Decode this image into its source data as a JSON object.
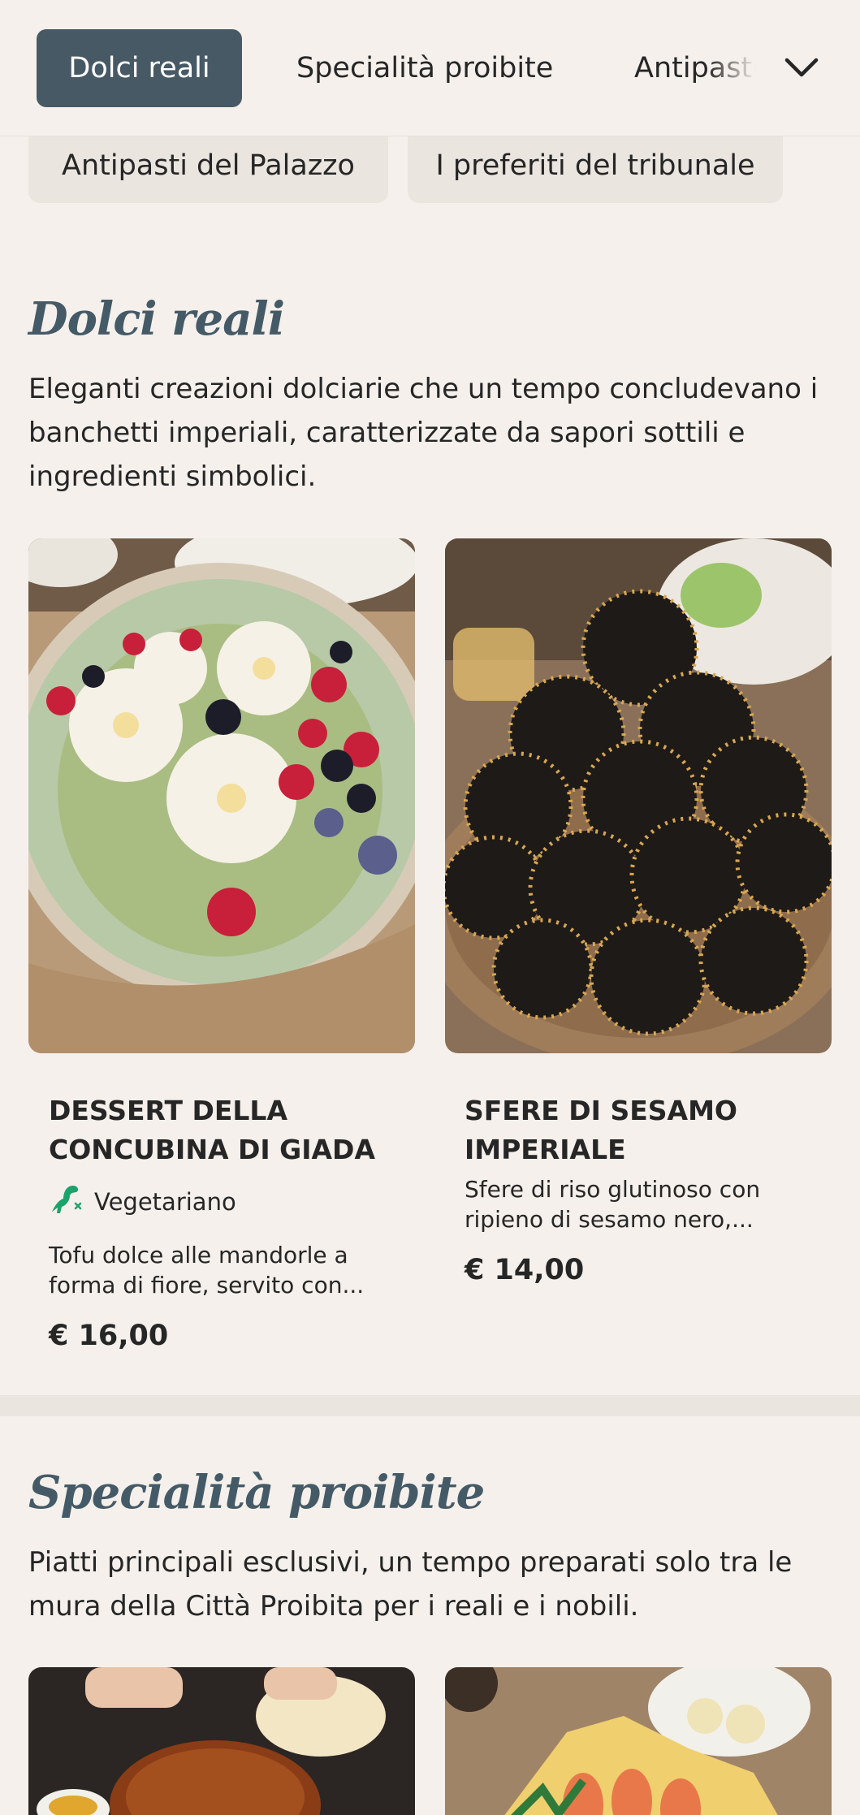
{
  "nav": {
    "tabs": [
      {
        "label": "Dolci reali",
        "active": true
      },
      {
        "label": "Specialità proibite",
        "active": false
      },
      {
        "label": "Antipasti del Palazzo",
        "active": false
      }
    ],
    "more_icon": "chevron-down-icon"
  },
  "chips": [
    {
      "label": "Antipasti del Palazzo"
    },
    {
      "label": "I preferiti del tribunale"
    }
  ],
  "sections": [
    {
      "title": "Dolci reali",
      "description": "Eleganti creazioni dolciarie che un tempo concludevano i banchetti imperiali, caratterizzate da sapori sottili e ingredienti simbolici.",
      "items": [
        {
          "name": "Dessert della Concubina di Giada",
          "badge": "Vegetariano",
          "badge_icon": "dinosaur-icon",
          "description": "Tofu dolce alle mandorle a forma di fiore, servito con...",
          "price": "€ 16,00"
        },
        {
          "name": "Sfere di sesamo imperiale",
          "description": "Sfere di riso glutinoso con ripieno di sesamo nero,...",
          "price": "€ 14,00"
        }
      ]
    },
    {
      "title": "Specialità proibite",
      "description": "Piatti principali esclusivi, un tempo preparati solo tra le mura della Città Proibita per i reali e i nobili."
    }
  ],
  "colors": {
    "background": "#f5f0eb",
    "accent": "#485966",
    "heading": "#455a67",
    "veg_icon": "#1aa36b"
  }
}
